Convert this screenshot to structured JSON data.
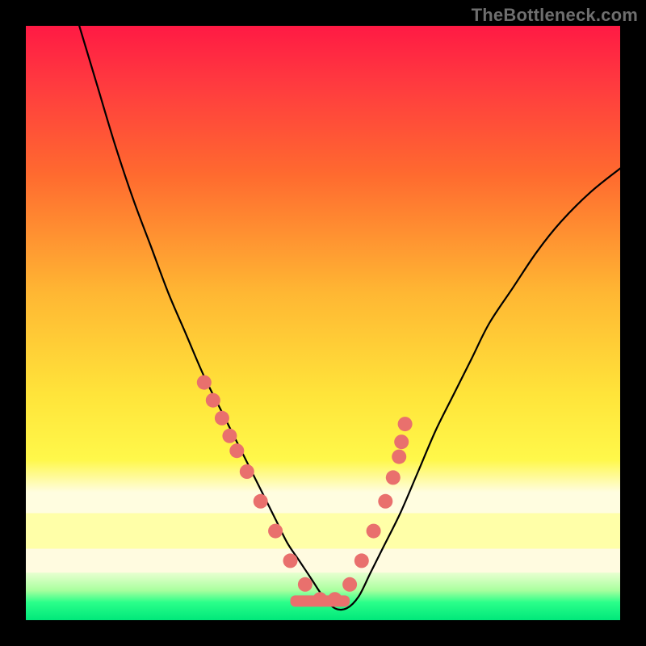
{
  "watermark": "TheBottleneck.com",
  "colors": {
    "curve": "#000000",
    "dots": "#e9706d",
    "dots_stroke": "#b94f4a"
  },
  "chart_data": {
    "type": "line",
    "title": "",
    "xlabel": "",
    "ylabel": "",
    "xlim": [
      0,
      100
    ],
    "ylim": [
      0,
      100
    ],
    "note": "No numeric axis ticks are visible. x and y values are normalized 0–100 positions within the plot area, read from pixels. y increases downward in screen space; higher y means closer to the bottom green band.",
    "series": [
      {
        "name": "black-curve",
        "x": [
          9,
          12,
          15,
          18,
          21,
          24,
          27,
          30,
          33,
          36,
          38,
          40,
          42,
          44,
          46,
          48,
          50,
          52,
          54,
          56,
          58,
          60,
          63,
          66,
          69,
          72,
          75,
          78,
          82,
          86,
          90,
          95,
          100
        ],
        "y": [
          0,
          10,
          20,
          29,
          37,
          45,
          52,
          59,
          65,
          71,
          75,
          79,
          83,
          87,
          90,
          93,
          96,
          98,
          98,
          96,
          92,
          88,
          82,
          75,
          68,
          62,
          56,
          50,
          44,
          38,
          33,
          28,
          24
        ]
      }
    ],
    "dots": {
      "name": "highlighted-points",
      "x": [
        30.0,
        31.5,
        33.0,
        34.3,
        35.5,
        37.2,
        39.5,
        42.0,
        44.5,
        47.0,
        49.5,
        52.0,
        54.5,
        56.5,
        58.5,
        60.5,
        61.8,
        62.8,
        63.2,
        63.8
      ],
      "y": [
        60.0,
        63.0,
        66.0,
        69.0,
        71.5,
        75.0,
        80.0,
        85.0,
        90.0,
        94.0,
        96.5,
        96.5,
        94.0,
        90.0,
        85.0,
        80.0,
        76.0,
        72.5,
        70.0,
        67.0
      ]
    },
    "bottom_bar": {
      "name": "flat-segment",
      "x_start": 44.5,
      "x_end": 54.5,
      "y": 96.8
    }
  }
}
